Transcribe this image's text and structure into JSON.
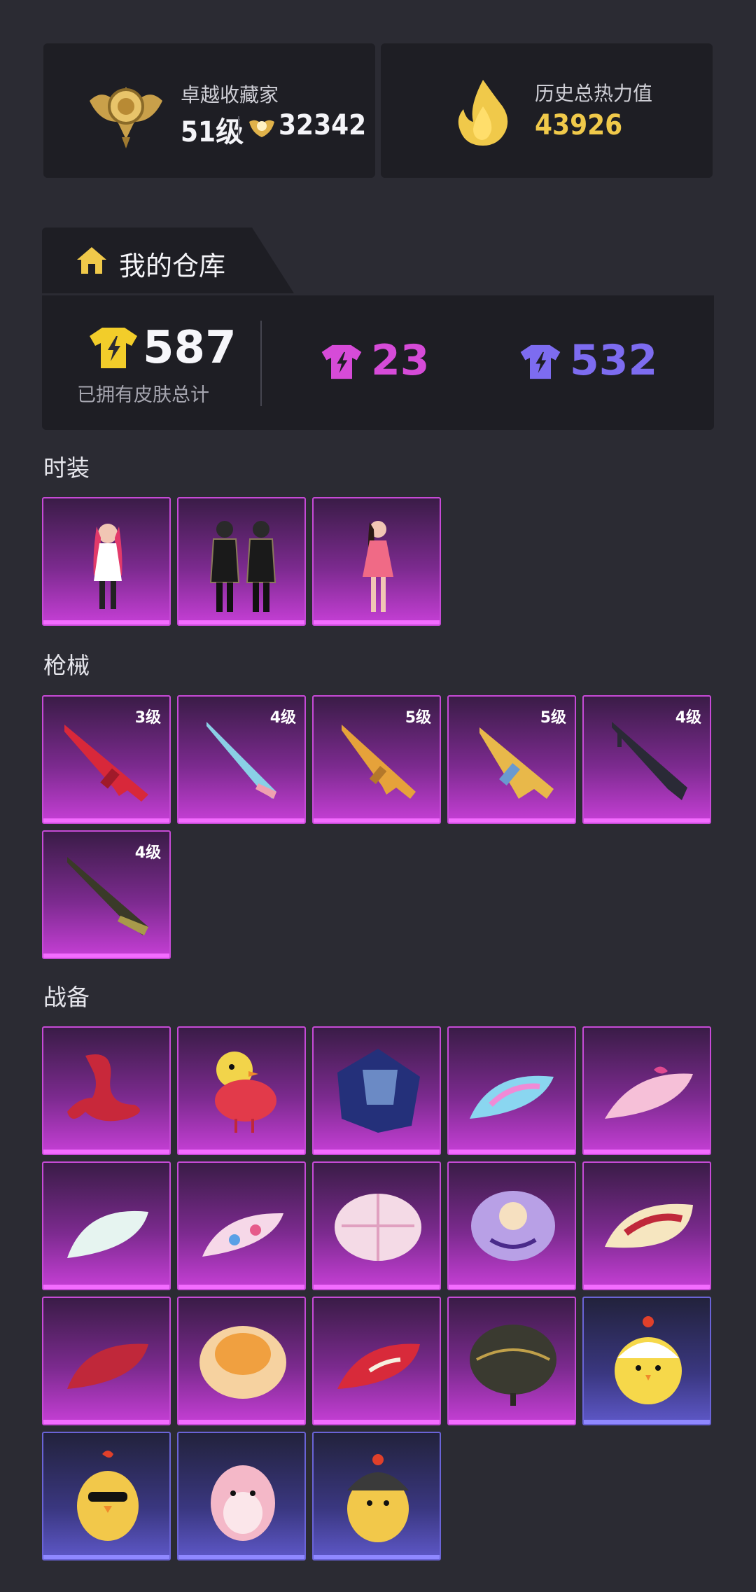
{
  "profile": {
    "title": "卓越收藏家",
    "level": "51级",
    "points": "32342"
  },
  "heat": {
    "label": "历史总热力值",
    "value": "43926"
  },
  "warehouse": {
    "title": "我的仓库",
    "total_count": "587",
    "total_label": "已拥有皮肤总计",
    "purple_count": "23",
    "blue_count": "532"
  },
  "sections": {
    "fashion": "时装",
    "guns": "枪械",
    "gear": "战备"
  },
  "gun_levels": [
    "3级",
    "4级",
    "5级",
    "5级",
    "4级",
    "4级"
  ],
  "colors": {
    "gold": "#f0c94a",
    "purple_shirt": "#d64bd8",
    "blue_shirt": "#7d6cf0",
    "tile_purple": "#c63fd6",
    "tile_blue": "#5e58c8"
  }
}
